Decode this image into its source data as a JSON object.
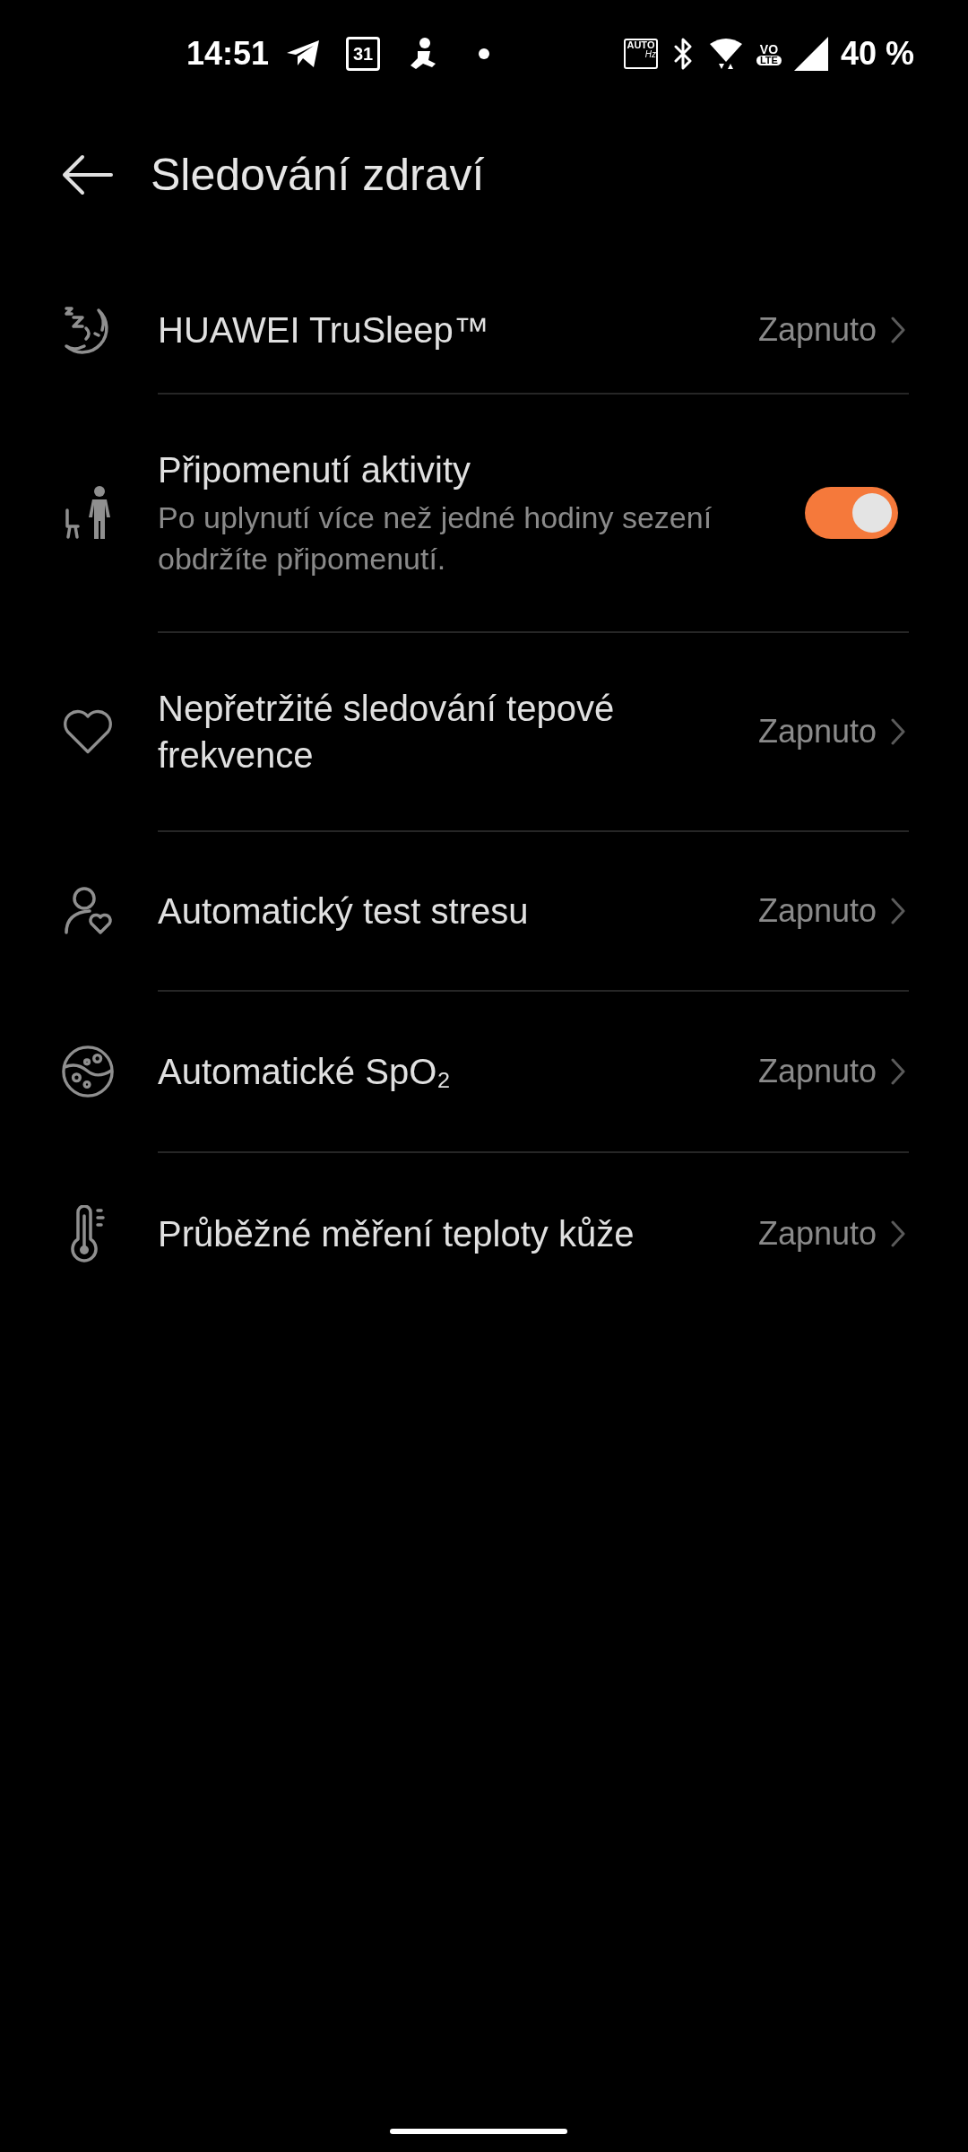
{
  "status_bar": {
    "time": "14:51",
    "calendar_day": "31",
    "refresh_rate": [
      "AUTO",
      "Hz"
    ],
    "volte": [
      "VO",
      "LTE"
    ],
    "battery": "40 %"
  },
  "header": {
    "title": "Sledování zdraví"
  },
  "settings": [
    {
      "kind": "link",
      "title": "HUAWEI TruSleep™",
      "value": "Zapnuto"
    },
    {
      "kind": "toggle",
      "title": "Připomenutí aktivity",
      "subtitle": "Po uplynutí více než jedné hodiny sezení obdržíte připomenutí.",
      "on": true
    },
    {
      "kind": "link",
      "title": "Nepřetržité sledování tepové frekvence",
      "value": "Zapnuto"
    },
    {
      "kind": "link",
      "title": "Automatický test stresu",
      "value": "Zapnuto"
    },
    {
      "kind": "link",
      "title": "Automatické SpO₂",
      "value": "Zapnuto"
    },
    {
      "kind": "link",
      "title": "Průběžné měření teploty kůže",
      "value": "Zapnuto"
    }
  ]
}
